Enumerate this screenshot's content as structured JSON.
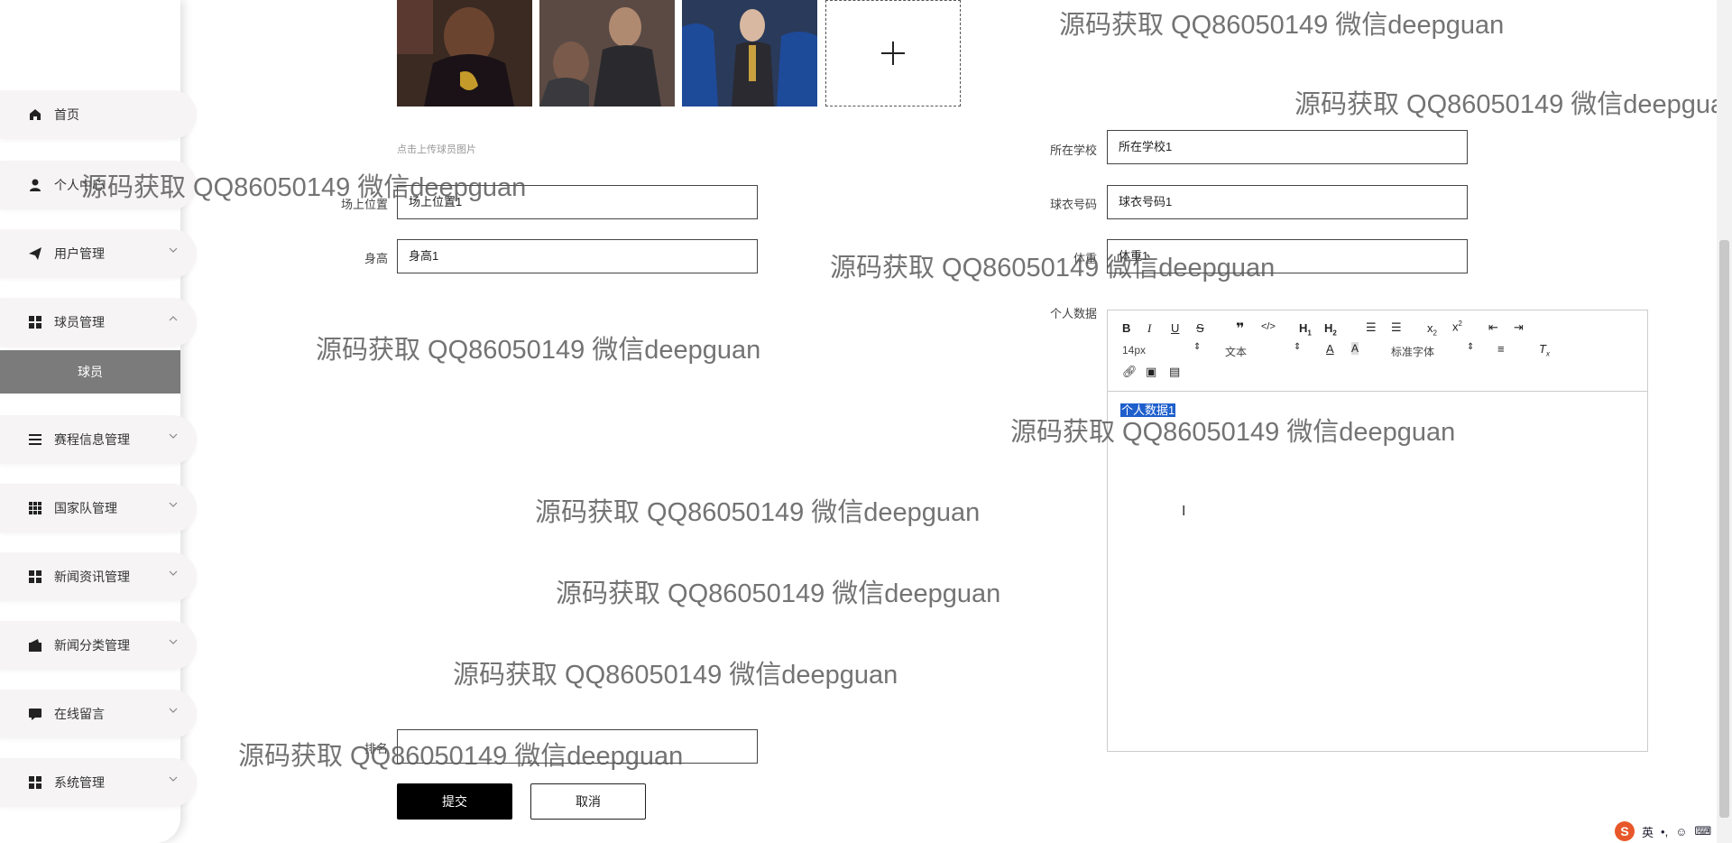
{
  "sidebar": {
    "items": [
      {
        "label": "首页",
        "icon": "home-icon"
      },
      {
        "label": "个人中心",
        "icon": "user-icon"
      },
      {
        "label": "用户管理",
        "icon": "send-icon"
      },
      {
        "label": "球员管理",
        "icon": "grid-icon"
      },
      {
        "label": "赛程信息管理",
        "icon": "list-icon"
      },
      {
        "label": "国家队管理",
        "icon": "apps-icon"
      },
      {
        "label": "新闻资讯管理",
        "icon": "grid-icon"
      },
      {
        "label": "新闻分类管理",
        "icon": "wallet-icon"
      },
      {
        "label": "在线留言",
        "icon": "chat-icon"
      },
      {
        "label": "系统管理",
        "icon": "grid-icon"
      }
    ],
    "sub_item": "球员"
  },
  "form": {
    "upload_hint": "点击上传球员图片",
    "position_label": "场上位置",
    "position_value": "场上位置1",
    "height_label": "身高",
    "height_value": "身高1",
    "school_label": "所在学校",
    "school_value": "所在学校1",
    "jersey_label": "球衣号码",
    "jersey_value": "球衣号码1",
    "weight_label": "体重",
    "weight_value": "体重1",
    "personal_label": "个人数据",
    "editor_content": "个人数据1",
    "rank_label": "排名",
    "rank_value": "",
    "submit_label": "提交",
    "cancel_label": "取消"
  },
  "editor_toolbar": {
    "font_size": "14px",
    "block": "文本",
    "font_family": "标准字体"
  },
  "watermark_text": "源码获取 QQ86050149 微信deepguan",
  "tray": {
    "ime": "英"
  }
}
